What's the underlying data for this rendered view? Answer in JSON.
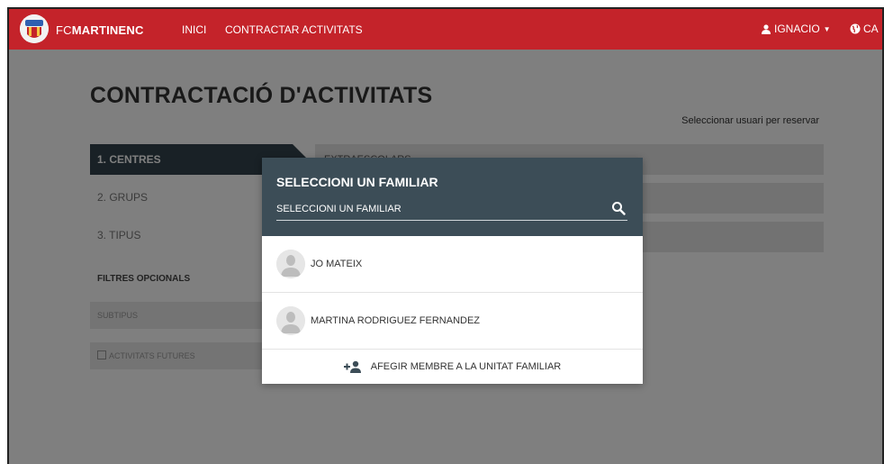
{
  "navbar": {
    "brand_prefix": "FC",
    "brand_name": "MARTINENC",
    "links": [
      {
        "label": "INICI"
      },
      {
        "label": "CONTRACTAR ACTIVITATS"
      }
    ],
    "user_label": "IGNACIO",
    "language_label": "CA",
    "color": "#c4232a"
  },
  "page": {
    "title": "CONTRACTACIÓ D'ACTIVITATS",
    "select_user_link": "Seleccionar usuari per reservar"
  },
  "steps": [
    {
      "label": "1. CENTRES",
      "active": true
    },
    {
      "label": "2. GRUPS",
      "active": false
    },
    {
      "label": "3. TIPUS",
      "active": false
    }
  ],
  "filters": {
    "title": "FILTRES OPCIONALS",
    "subtipus_label": "SUBTIPUS",
    "futures_label": "ACTIVITATS FUTURES"
  },
  "categories": [
    {
      "label": "EXTRAESCOLARS"
    },
    {
      "label": ""
    },
    {
      "label": ""
    }
  ],
  "modal": {
    "title": "SELECCIONI UN FAMILIAR",
    "search_placeholder": "SELECCIONI UN FAMILIAR",
    "members": [
      {
        "name": "JO MATEIX",
        "avatar_icon": "user-avatar-icon"
      },
      {
        "name": "MARTINA RODRIGUEZ FERNANDEZ",
        "avatar_icon": "user-avatar-icon"
      }
    ],
    "add_member_label": "AFEGIR MEMBRE A LA UNITAT FAMILIAR",
    "add_member_icon": "person-add-icon",
    "header_color": "#3c4d57"
  }
}
